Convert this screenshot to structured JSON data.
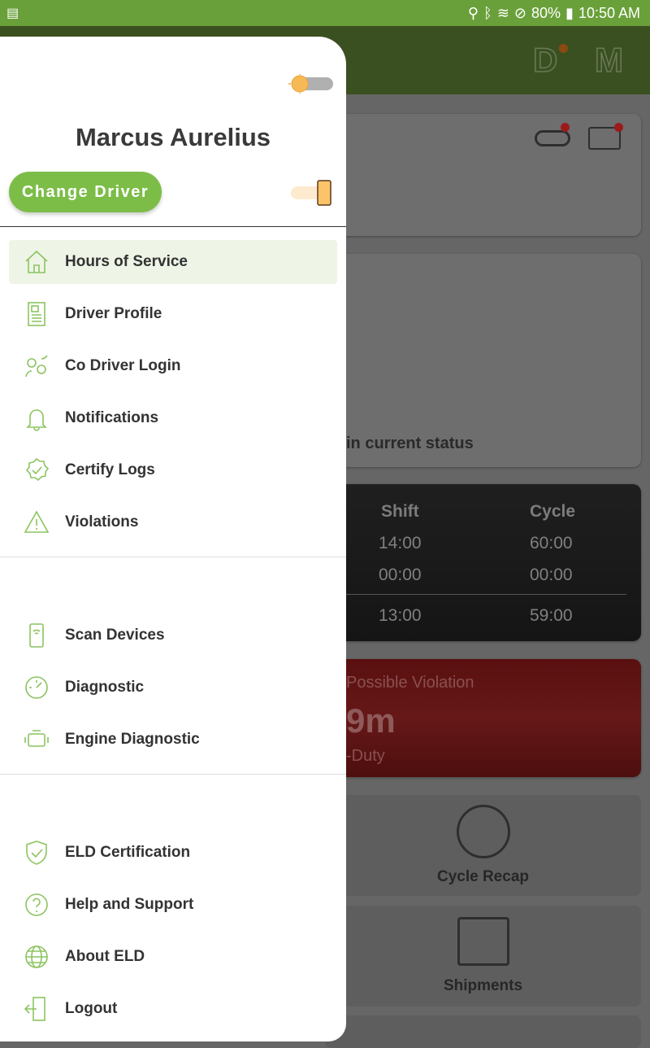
{
  "status_bar": {
    "battery": "80%",
    "time": "10:50 AM"
  },
  "header": {
    "letter_d": "D",
    "letter_m": "M"
  },
  "background": {
    "status_text": "in current status",
    "hos_table": {
      "headers": [
        "Shift",
        "Cycle"
      ],
      "rows": [
        [
          "14:00",
          "60:00"
        ],
        [
          "00:00",
          "00:00"
        ],
        [
          "13:00",
          "59:00"
        ]
      ]
    },
    "violation": {
      "title": "Possible Violation",
      "value": "9m",
      "subtitle": "-Duty"
    },
    "tiles": [
      "Cycle Recap",
      "Shipments"
    ]
  },
  "drawer": {
    "driver_name": "Marcus Aurelius",
    "change_driver_label": "Change Driver",
    "sections": [
      [
        {
          "label": "Hours of Service",
          "icon": "home-icon",
          "active": true
        },
        {
          "label": "Driver Profile",
          "icon": "profile-icon"
        },
        {
          "label": "Co Driver Login",
          "icon": "co-driver-icon"
        },
        {
          "label": "Notifications",
          "icon": "bell-icon"
        },
        {
          "label": "Certify Logs",
          "icon": "certify-icon"
        },
        {
          "label": "Violations",
          "icon": "warning-icon"
        }
      ],
      [
        {
          "label": "Scan Devices",
          "icon": "scan-device-icon"
        },
        {
          "label": "Diagnostic",
          "icon": "gauge-icon"
        },
        {
          "label": "Engine Diagnostic",
          "icon": "engine-icon"
        }
      ],
      [
        {
          "label": "ELD Certification",
          "icon": "shield-check-icon"
        },
        {
          "label": "Help and Support",
          "icon": "help-icon"
        },
        {
          "label": "About ELD",
          "icon": "globe-icon"
        },
        {
          "label": "Logout",
          "icon": "logout-icon"
        }
      ]
    ]
  },
  "colors": {
    "accent": "#7cbd47",
    "status_bar": "#6aa03a"
  }
}
